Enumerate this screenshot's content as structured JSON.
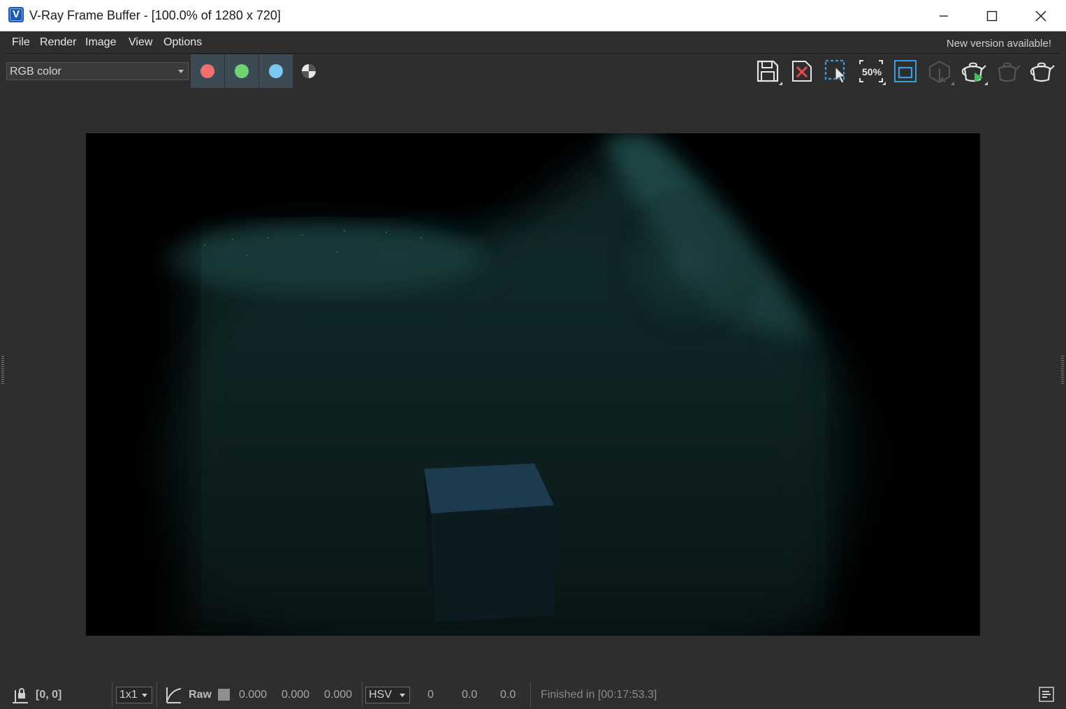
{
  "window": {
    "title": "V-Ray Frame Buffer - [100.0% of 1280 x 720]",
    "app_icon_letter": "V"
  },
  "menu": {
    "items": [
      "File",
      "Render",
      "Image",
      "View",
      "Options"
    ],
    "notice": "New version available!"
  },
  "toolbar": {
    "channel": "RGB color",
    "channel_buttons": [
      {
        "name": "red-channel",
        "color": "#f26f6f"
      },
      {
        "name": "green-channel",
        "color": "#6fd46f"
      },
      {
        "name": "blue-channel",
        "color": "#7ac8f4"
      }
    ],
    "tools": [
      "save-image-icon",
      "clear-image-icon",
      "region-render-icon",
      "zoom-50-icon",
      "render-region-frame-icon",
      "interactive-render-icon",
      "start-render-icon",
      "stop-render-icon",
      "render-teapot-icon"
    ],
    "zoom_label": "50%"
  },
  "status": {
    "coords": "[0, 0]",
    "sample_size": "1x1",
    "raw_label": "Raw",
    "rgb": [
      "0.000",
      "0.000",
      "0.000"
    ],
    "color_mode": "HSV",
    "hsv": [
      "0",
      "0.0",
      "0.0"
    ],
    "message": "Finished in [00:17:53.3]"
  },
  "colors": {
    "accent_blue": "#1c5bb5",
    "toolbar_icon_blue": "#3a9ee0",
    "render_green": "#3fbf5a"
  }
}
